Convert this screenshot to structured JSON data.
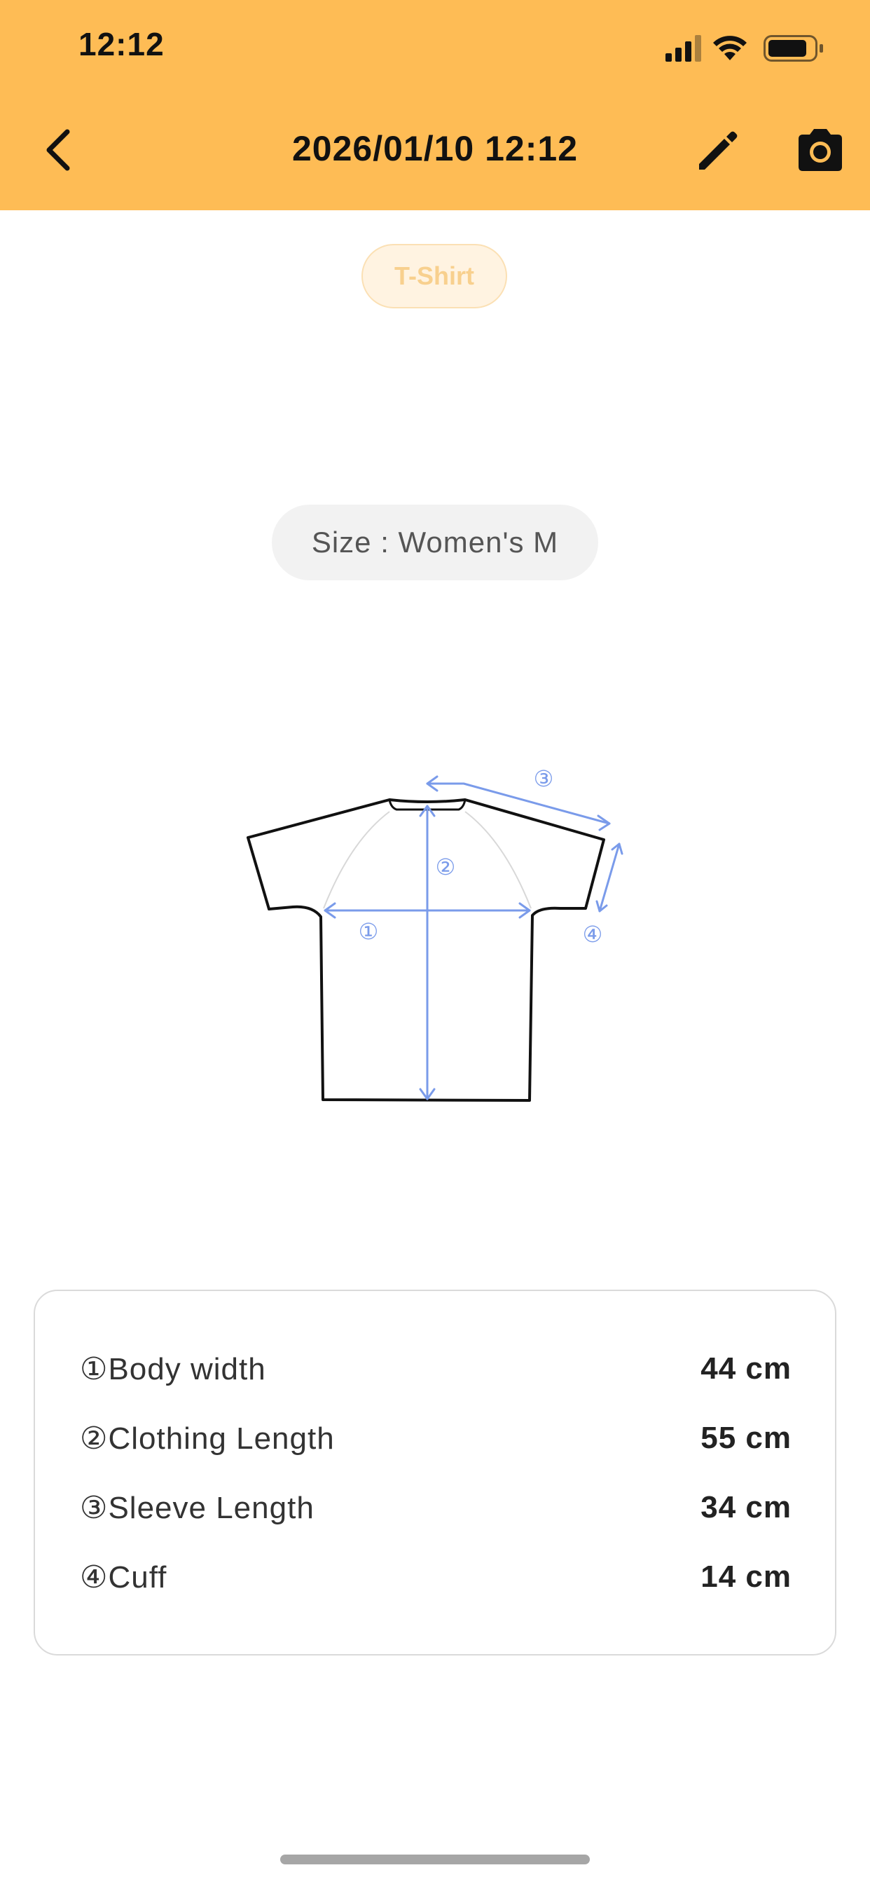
{
  "status_bar": {
    "time": "12:12"
  },
  "nav": {
    "title": "2026/01/10 12:12",
    "back_icon": "chevron-left-icon",
    "edit_icon": "pencil-icon",
    "camera_icon": "camera-icon"
  },
  "category": {
    "label": "T-Shirt"
  },
  "size": {
    "label": "Size : Women's M"
  },
  "diagram": {
    "markers": [
      "①",
      "②",
      "③",
      "④"
    ]
  },
  "measurements": [
    {
      "label": "①Body width",
      "value": "44 cm"
    },
    {
      "label": "②Clothing Length",
      "value": "55 cm"
    },
    {
      "label": "③Sleeve Length",
      "value": "34 cm"
    },
    {
      "label": "④Cuff",
      "value": "14 cm"
    }
  ],
  "colors": {
    "header": "#FEBC55",
    "chip_bg": "#FFF3E1",
    "chip_text": "#F8D08E",
    "measure_line": "#7A9BEA"
  }
}
